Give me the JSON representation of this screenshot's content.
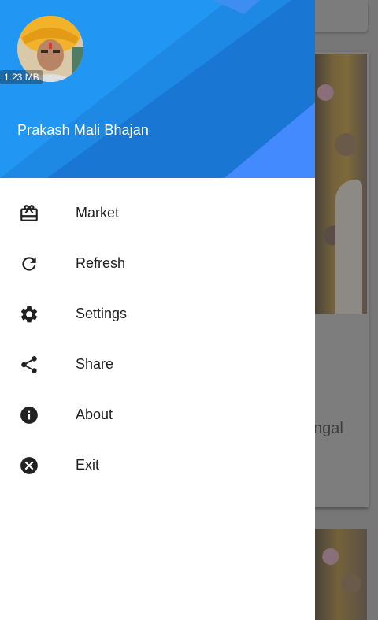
{
  "background": {
    "partial_text": "ngal"
  },
  "drawer": {
    "header": {
      "size_badge": "1.23 MB",
      "app_name": "Prakash Mali Bhajan",
      "colors": {
        "base": "#2196f3",
        "dark": "#1976d2",
        "accent": "#448aff"
      }
    },
    "menu": [
      {
        "label": "Market",
        "icon": "gift-card-icon"
      },
      {
        "label": "Refresh",
        "icon": "refresh-icon"
      },
      {
        "label": "Settings",
        "icon": "gear-icon"
      },
      {
        "label": "Share",
        "icon": "share-icon"
      },
      {
        "label": "About",
        "icon": "info-icon"
      },
      {
        "label": "Exit",
        "icon": "close-circle-icon"
      }
    ]
  }
}
